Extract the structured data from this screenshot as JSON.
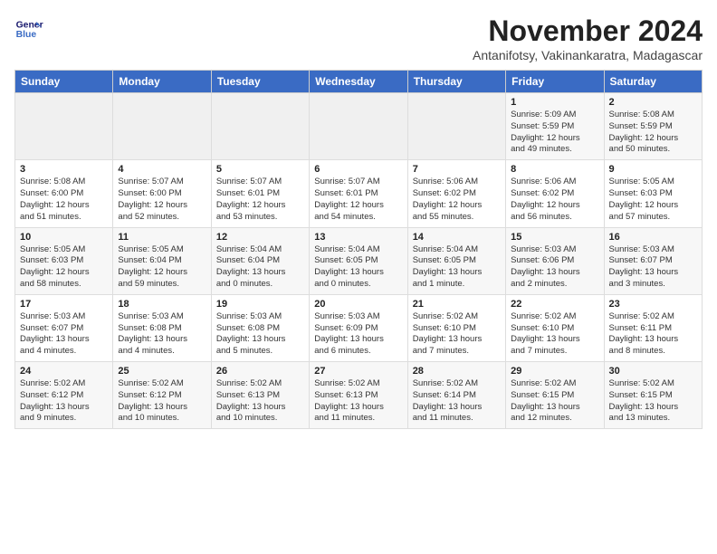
{
  "header": {
    "logo_line1": "General",
    "logo_line2": "Blue",
    "month_title": "November 2024",
    "subtitle": "Antanifotsy, Vakinankaratra, Madagascar"
  },
  "weekdays": [
    "Sunday",
    "Monday",
    "Tuesday",
    "Wednesday",
    "Thursday",
    "Friday",
    "Saturday"
  ],
  "weeks": [
    [
      {
        "day": "",
        "info": ""
      },
      {
        "day": "",
        "info": ""
      },
      {
        "day": "",
        "info": ""
      },
      {
        "day": "",
        "info": ""
      },
      {
        "day": "",
        "info": ""
      },
      {
        "day": "1",
        "info": "Sunrise: 5:09 AM\nSunset: 5:59 PM\nDaylight: 12 hours\nand 49 minutes."
      },
      {
        "day": "2",
        "info": "Sunrise: 5:08 AM\nSunset: 5:59 PM\nDaylight: 12 hours\nand 50 minutes."
      }
    ],
    [
      {
        "day": "3",
        "info": "Sunrise: 5:08 AM\nSunset: 6:00 PM\nDaylight: 12 hours\nand 51 minutes."
      },
      {
        "day": "4",
        "info": "Sunrise: 5:07 AM\nSunset: 6:00 PM\nDaylight: 12 hours\nand 52 minutes."
      },
      {
        "day": "5",
        "info": "Sunrise: 5:07 AM\nSunset: 6:01 PM\nDaylight: 12 hours\nand 53 minutes."
      },
      {
        "day": "6",
        "info": "Sunrise: 5:07 AM\nSunset: 6:01 PM\nDaylight: 12 hours\nand 54 minutes."
      },
      {
        "day": "7",
        "info": "Sunrise: 5:06 AM\nSunset: 6:02 PM\nDaylight: 12 hours\nand 55 minutes."
      },
      {
        "day": "8",
        "info": "Sunrise: 5:06 AM\nSunset: 6:02 PM\nDaylight: 12 hours\nand 56 minutes."
      },
      {
        "day": "9",
        "info": "Sunrise: 5:05 AM\nSunset: 6:03 PM\nDaylight: 12 hours\nand 57 minutes."
      }
    ],
    [
      {
        "day": "10",
        "info": "Sunrise: 5:05 AM\nSunset: 6:03 PM\nDaylight: 12 hours\nand 58 minutes."
      },
      {
        "day": "11",
        "info": "Sunrise: 5:05 AM\nSunset: 6:04 PM\nDaylight: 12 hours\nand 59 minutes."
      },
      {
        "day": "12",
        "info": "Sunrise: 5:04 AM\nSunset: 6:04 PM\nDaylight: 13 hours\nand 0 minutes."
      },
      {
        "day": "13",
        "info": "Sunrise: 5:04 AM\nSunset: 6:05 PM\nDaylight: 13 hours\nand 0 minutes."
      },
      {
        "day": "14",
        "info": "Sunrise: 5:04 AM\nSunset: 6:05 PM\nDaylight: 13 hours\nand 1 minute."
      },
      {
        "day": "15",
        "info": "Sunrise: 5:03 AM\nSunset: 6:06 PM\nDaylight: 13 hours\nand 2 minutes."
      },
      {
        "day": "16",
        "info": "Sunrise: 5:03 AM\nSunset: 6:07 PM\nDaylight: 13 hours\nand 3 minutes."
      }
    ],
    [
      {
        "day": "17",
        "info": "Sunrise: 5:03 AM\nSunset: 6:07 PM\nDaylight: 13 hours\nand 4 minutes."
      },
      {
        "day": "18",
        "info": "Sunrise: 5:03 AM\nSunset: 6:08 PM\nDaylight: 13 hours\nand 4 minutes."
      },
      {
        "day": "19",
        "info": "Sunrise: 5:03 AM\nSunset: 6:08 PM\nDaylight: 13 hours\nand 5 minutes."
      },
      {
        "day": "20",
        "info": "Sunrise: 5:03 AM\nSunset: 6:09 PM\nDaylight: 13 hours\nand 6 minutes."
      },
      {
        "day": "21",
        "info": "Sunrise: 5:02 AM\nSunset: 6:10 PM\nDaylight: 13 hours\nand 7 minutes."
      },
      {
        "day": "22",
        "info": "Sunrise: 5:02 AM\nSunset: 6:10 PM\nDaylight: 13 hours\nand 7 minutes."
      },
      {
        "day": "23",
        "info": "Sunrise: 5:02 AM\nSunset: 6:11 PM\nDaylight: 13 hours\nand 8 minutes."
      }
    ],
    [
      {
        "day": "24",
        "info": "Sunrise: 5:02 AM\nSunset: 6:12 PM\nDaylight: 13 hours\nand 9 minutes."
      },
      {
        "day": "25",
        "info": "Sunrise: 5:02 AM\nSunset: 6:12 PM\nDaylight: 13 hours\nand 10 minutes."
      },
      {
        "day": "26",
        "info": "Sunrise: 5:02 AM\nSunset: 6:13 PM\nDaylight: 13 hours\nand 10 minutes."
      },
      {
        "day": "27",
        "info": "Sunrise: 5:02 AM\nSunset: 6:13 PM\nDaylight: 13 hours\nand 11 minutes."
      },
      {
        "day": "28",
        "info": "Sunrise: 5:02 AM\nSunset: 6:14 PM\nDaylight: 13 hours\nand 11 minutes."
      },
      {
        "day": "29",
        "info": "Sunrise: 5:02 AM\nSunset: 6:15 PM\nDaylight: 13 hours\nand 12 minutes."
      },
      {
        "day": "30",
        "info": "Sunrise: 5:02 AM\nSunset: 6:15 PM\nDaylight: 13 hours\nand 13 minutes."
      }
    ]
  ]
}
